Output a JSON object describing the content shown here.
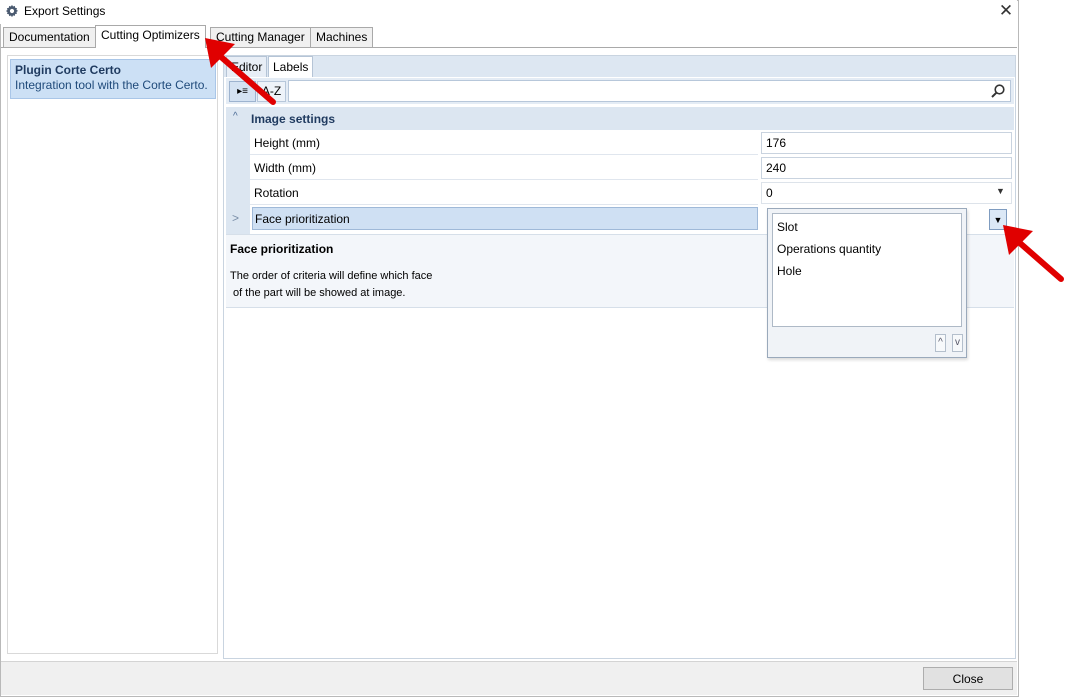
{
  "window": {
    "title": "Export Settings",
    "close_symbol": "✕"
  },
  "main_tabs": [
    {
      "label": "Documentation"
    },
    {
      "label": "Cutting Optimizers"
    },
    {
      "label": "Cutting Manager"
    },
    {
      "label": "Machines"
    }
  ],
  "plugin": {
    "title": "Plugin Corte Certo",
    "description": "Integration tool with the Corte Certo."
  },
  "sub_tabs": [
    {
      "label": "Editor"
    },
    {
      "label": "Labels"
    }
  ],
  "toolbar": {
    "categorized_label": "▸≡",
    "alphabetical_label": "A-Z",
    "search_placeholder": ""
  },
  "category": {
    "label": "Image settings",
    "chevron": "^"
  },
  "properties": [
    {
      "name": "Height (mm)",
      "value": "176"
    },
    {
      "name": "Width (mm)",
      "value": "240"
    },
    {
      "name": "Rotation",
      "value": "0"
    },
    {
      "name": "Face prioritization",
      "value": ""
    }
  ],
  "description": {
    "title": "Face prioritization",
    "text": "The order of criteria will define which face\n of the part will be showed at image."
  },
  "popup": {
    "items": [
      "Slot",
      "Operations quantity",
      "Hole"
    ],
    "up_label": "^",
    "down_label": "v"
  },
  "footer": {
    "close_label": "Close"
  },
  "colors": {
    "selection": "#cce0f5",
    "annotation_arrow": "#e00000"
  }
}
